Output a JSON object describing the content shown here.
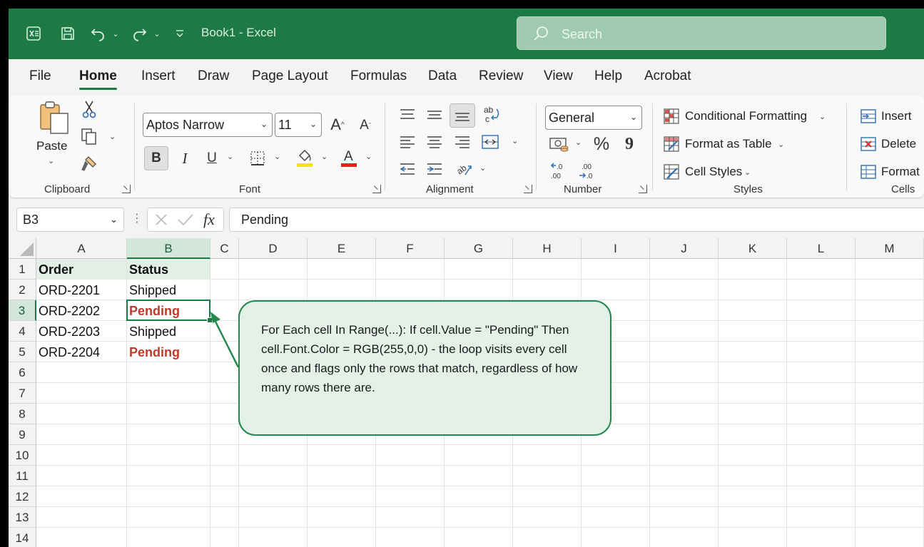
{
  "window": {
    "doc_title": "Book1  -  Excel",
    "search_placeholder": "Search"
  },
  "menu": {
    "tabs": [
      "File",
      "Home",
      "Insert",
      "Draw",
      "Page Layout",
      "Formulas",
      "Data",
      "Review",
      "View",
      "Help",
      "Acrobat"
    ],
    "active": "Home"
  },
  "ribbon": {
    "clipboard": {
      "label": "Clipboard",
      "paste_label": "Paste"
    },
    "font": {
      "label": "Font",
      "font_name": "Aptos Narrow",
      "font_size": "11",
      "bold": "B",
      "italic": "I",
      "underline": "U"
    },
    "alignment": {
      "label": "Alignment"
    },
    "number": {
      "label": "Number",
      "format": "General",
      "percent": "%",
      "comma": "9"
    },
    "styles": {
      "label": "Styles",
      "conditional_formatting": "Conditional Formatting",
      "format_as_table": "Format as Table",
      "cell_styles": "Cell Styles"
    },
    "cells": {
      "label": "Cells",
      "insert": "Insert",
      "delete": "Delete",
      "format": "Format"
    }
  },
  "formula_bar": {
    "name_box": "B3",
    "fx": "fx",
    "formula": "Pending"
  },
  "grid": {
    "columns": [
      "A",
      "B",
      "C",
      "D",
      "E",
      "F",
      "G",
      "H",
      "I",
      "J",
      "K",
      "L",
      "M"
    ],
    "rows": [
      "1",
      "2",
      "3",
      "4",
      "5",
      "6",
      "7",
      "8",
      "9",
      "10",
      "11",
      "12",
      "13",
      "14"
    ],
    "selected_cell": "B3",
    "header": {
      "order": "Order",
      "status": "Status"
    },
    "data": [
      {
        "order": "ORD-2201",
        "status": "Shipped",
        "pending": false
      },
      {
        "order": "ORD-2202",
        "status": "Pending",
        "pending": true
      },
      {
        "order": "ORD-2203",
        "status": "Shipped",
        "pending": false
      },
      {
        "order": "ORD-2204",
        "status": "Pending",
        "pending": true
      }
    ]
  },
  "callout": {
    "text": "For Each cell In Range(...): If cell.Value = \"Pending\" Then cell.Font.Color = RGB(255,0,0) - the loop visits every cell once and flags only the rows that match, regardless of how many rows there are."
  },
  "colors": {
    "excel_green": "#1d7a45",
    "pending_red": "#c0392b",
    "callout_fill": "#e3f1e8"
  }
}
